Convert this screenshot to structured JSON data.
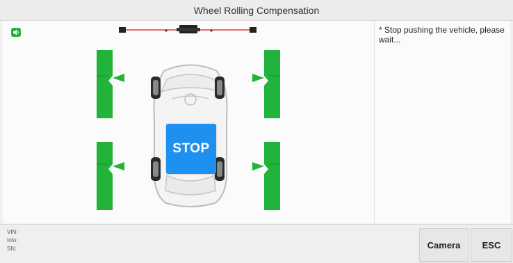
{
  "header": {
    "title": "Wheel Rolling Compensation"
  },
  "main": {
    "stop_label": "STOP",
    "message": "* Stop pushing the vehicle, please wait..."
  },
  "footer": {
    "vin_label": "VIN:",
    "info_label": "Info:",
    "sn_label": "SN:"
  },
  "buttons": {
    "camera": "Camera",
    "esc": "ESC"
  },
  "icons": {
    "speaker": "speaker-icon",
    "vehicle": "vehicle-top-view-icon",
    "measuring_sensor": "sensor-bar-icon",
    "target_board": "target-board-icon"
  },
  "colors": {
    "target_green": "#22b33a",
    "stop_blue": "#1e90f0",
    "sensor_bar_red": "#e53935"
  }
}
